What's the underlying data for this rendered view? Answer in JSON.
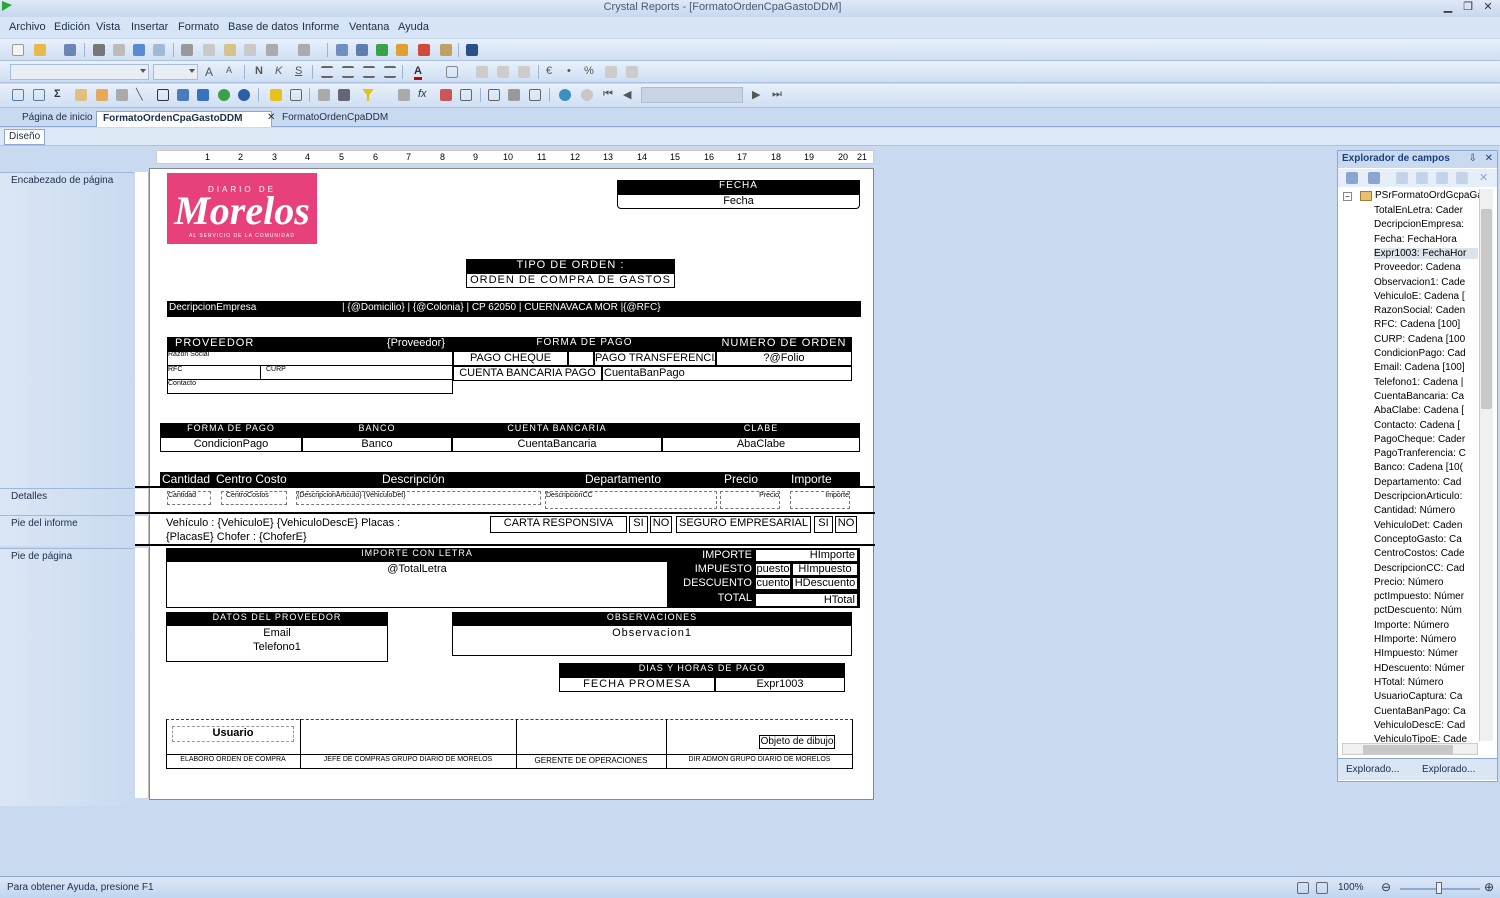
{
  "window": {
    "title": "Crystal Reports - [FormatoOrdenCpaGastoDDM]"
  },
  "menu": [
    "Archivo",
    "Edición",
    "Vista",
    "Insertar",
    "Formato",
    "Base de datos",
    "Informe",
    "Ventana",
    "Ayuda"
  ],
  "tabs": {
    "home": "Página de inicio",
    "active": "FormatoOrdenCpaGastoDDM",
    "other": "FormatoOrdenCpaDDM",
    "design": "Diseño"
  },
  "toolbar": {
    "bold": "N",
    "italic": "K",
    "underline": "S",
    "font_color": "A",
    "euro": "€",
    "percent": "%",
    "formula": "fx"
  },
  "sections": {
    "header": "Encabezado de página",
    "details": "Detalles",
    "report_footer": "Pie del informe",
    "page_footer": "Pie de página"
  },
  "ruler": [
    "1",
    "2",
    "3",
    "4",
    "5",
    "6",
    "7",
    "8",
    "9",
    "10",
    "11",
    "12",
    "13",
    "14",
    "15",
    "16",
    "17",
    "18",
    "19",
    "20",
    "21"
  ],
  "report": {
    "logo_top": "DIARIO DE",
    "logo_name": "Morelos",
    "logo_sub": "AL SERVICIO DE LA COMUNIDAD",
    "fecha_label": "FECHA",
    "fecha_value": "Fecha",
    "tipo_label": "TIPO DE ORDEN :",
    "tipo_value": "ORDEN DE COMPRA DE GASTOS",
    "empresa_line": "DecripcionEmpresa",
    "address_line": "| {@Domicilio} | {@Colonia}    | CP 62050  | CUERNAVACA MOR  |{@RFC}",
    "proveedor_label": "PROVEEDOR",
    "proveedor_value": "{Proveedor}",
    "razon_social": "Razon Social",
    "rfc": "RFC",
    "curp": "CURP",
    "contacto": "Contacto",
    "forma_pago_hdr": "FORMA DE PAGO",
    "pago_cheque": "PAGO CHEQUE",
    "pago_transferencia": "PAGO TRANSFERENCIA",
    "cuenta_bancaria_pago": "CUENTA BANCARIA PAGO",
    "cuenta_ban_pago": "CuentaBanPago",
    "numero_orden_hdr": "NUMERO DE ORDEN",
    "folio": "?@Folio",
    "tbl_forma_pago": "FORMA DE PAGO",
    "tbl_banco": "BANCO",
    "tbl_cuenta": "CUENTA BANCARIA",
    "tbl_clabe": "CLABE",
    "val_condicion": "CondicionPago",
    "val_banco": "Banco",
    "val_cuenta": "CuentaBancaria",
    "val_clabe": "AbaClabe",
    "col_cantidad": "Cantidad",
    "col_centro": "Centro Costo",
    "col_descripcion": "Descripción",
    "col_departamento": "Departamento",
    "col_precio": "Precio",
    "col_importe": "Importe",
    "det_cantidad": "Cantidad",
    "det_centro": "CentroCostos",
    "det_descripcion": "{DescripcionArticulo} {VehiculoDet}",
    "det_departamento": "DescripcionCC",
    "det_precio": "Precio",
    "det_importe": "Importe",
    "vehiculo_line1": "Vehículo : {VehiculoE} {VehiculoDescE} Placas :",
    "vehiculo_line2": "{PlacasE} Chofer : {ChoferE}",
    "carta_responsiva": "CARTA RESPONSIVA",
    "si1": "SI",
    "no1": "NO",
    "seguro": "SEGURO EMPRESARIAL",
    "si2": "SI",
    "no2": "NO",
    "importe_letra_hdr": "IMPORTE CON LETRA",
    "total_letra": "@TotalLetra",
    "lbl_importe": "IMPORTE",
    "lbl_impuesto": "IMPUESTO",
    "lbl_descuento": "DESCUENTO",
    "lbl_total": "TOTAL",
    "val_importe": "HImporte",
    "val_impuesto_pct": "puesto",
    "val_impuesto": "HImpuesto",
    "val_descuento_pct": "cuento",
    "val_descuento": "HDescuento",
    "val_total": "HTotal",
    "datos_prov_hdr": "DATOS DEL PROVEEDOR",
    "email": "Email",
    "telefono": "Telefono1",
    "observaciones_hdr": "OBSERVACIONES",
    "observacion": "Observacion1",
    "dias_pago_hdr": "DIAS Y HORAS DE PAGO",
    "fecha_promesa": "FECHA PROMESA",
    "expr": "Expr1003",
    "usuario": "Usuario",
    "objeto_dibujo": "Objeto de dibujo",
    "sig_elaboro": "ELABORO ORDEN DE COMPRA",
    "sig_jefe": "JEFE DE COMPRAS GRUPO DIARIO DE MORELOS",
    "sig_gerente": "GERENTE DE OPERACIONES",
    "sig_dir": "DIR ADMON GRUPO DIARIO DE MORELOS"
  },
  "field_explorer": {
    "title": "Explorador de campos",
    "root": "PSrFormatoOrdGcpaGas",
    "fields": [
      "TotalEnLetra: Cader",
      "DecripcionEmpresa:",
      "Fecha: FechaHora",
      "Expr1003: FechaHor",
      "Proveedor: Cadena",
      "Observacion1: Cade",
      "VehiculoE: Cadena [",
      "RazonSocial: Caden",
      "RFC: Cadena [100]",
      "CURP: Cadena [100",
      "CondicionPago: Cad",
      "Email: Cadena [100]",
      "Telefono1: Cadena |",
      "CuentaBancaria: Ca",
      "AbaClabe: Cadena [",
      "Contacto: Cadena [",
      "PagoCheque: Cader",
      "PagoTranferencia: C",
      "Banco: Cadena [10(",
      "Departamento: Cad",
      "DescripcionArticulo:",
      "Cantidad: Número",
      "VehiculoDet: Caden",
      "ConceptoGasto: Ca",
      "CentroCostos: Cade",
      "DescripcionCC: Cad",
      "Precio: Número",
      "pctImpuesto: Númer",
      "pctDescuento: Núm",
      "Importe: Número",
      "HImporte: Número",
      "HImpuesto: Númer",
      "HDescuento: Númer",
      "HTotal: Número",
      "UsuarioCaptura: Ca",
      "CuentaBanPago: Ca",
      "VehiculoDescE: Cad",
      "VehiculoTipoE: Cade"
    ],
    "tab1": "Explorado...",
    "tab2": "Explorado..."
  },
  "status": {
    "help": "Para obtener Ayuda, presione F1",
    "zoom": "100%"
  }
}
